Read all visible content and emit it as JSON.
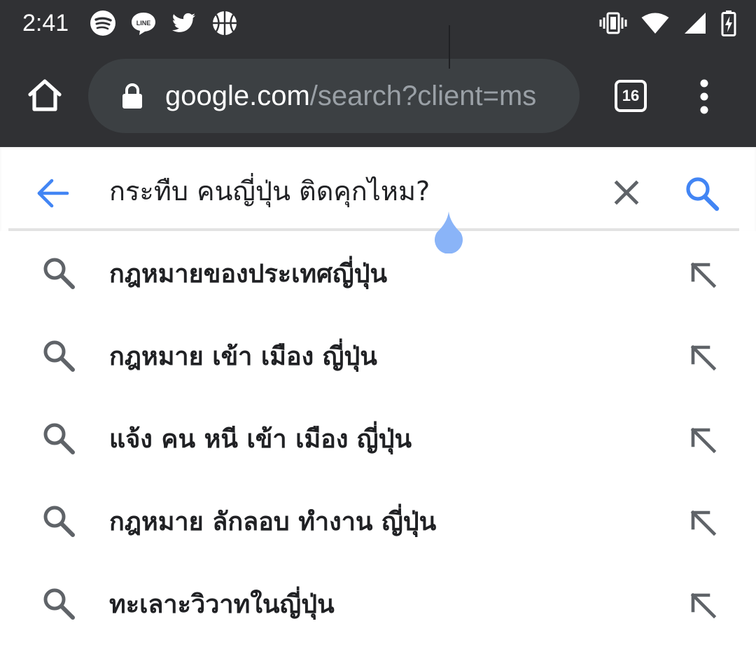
{
  "status_bar": {
    "time": "2:41",
    "notification_icons": [
      "spotify-icon",
      "line-icon",
      "twitter-icon",
      "basketball-icon"
    ],
    "system_icons": [
      "vibrate-icon",
      "wifi-icon",
      "signal-icon",
      "battery-charging-icon"
    ]
  },
  "toolbar": {
    "url_host": "google.com",
    "url_path": "/search?client=ms",
    "tab_count": "16"
  },
  "search": {
    "query": "กระทืบ คนญี่ปุ่น ติดคุกไหม?"
  },
  "suggestions": [
    {
      "text": "กฎหมายของประเทศญี่ปุ่น"
    },
    {
      "text": "กฎหมาย เข้า เมือง ญี่ปุ่น"
    },
    {
      "text": "แจ้ง คน หนี เข้า เมือง ญี่ปุ่น"
    },
    {
      "text": "กฎหมาย ลักลอบ ทำงาน ญี่ปุ่น"
    },
    {
      "text": "ทะเลาะวิวาทในญี่ปุ่น"
    }
  ],
  "colors": {
    "chrome_dark": "#303134",
    "omnibox": "#3c4043",
    "url_muted": "#9aa0a6",
    "accent_blue": "#4285f4",
    "handle_blue": "#8ab4f8",
    "icon_gray": "#5f6368"
  }
}
